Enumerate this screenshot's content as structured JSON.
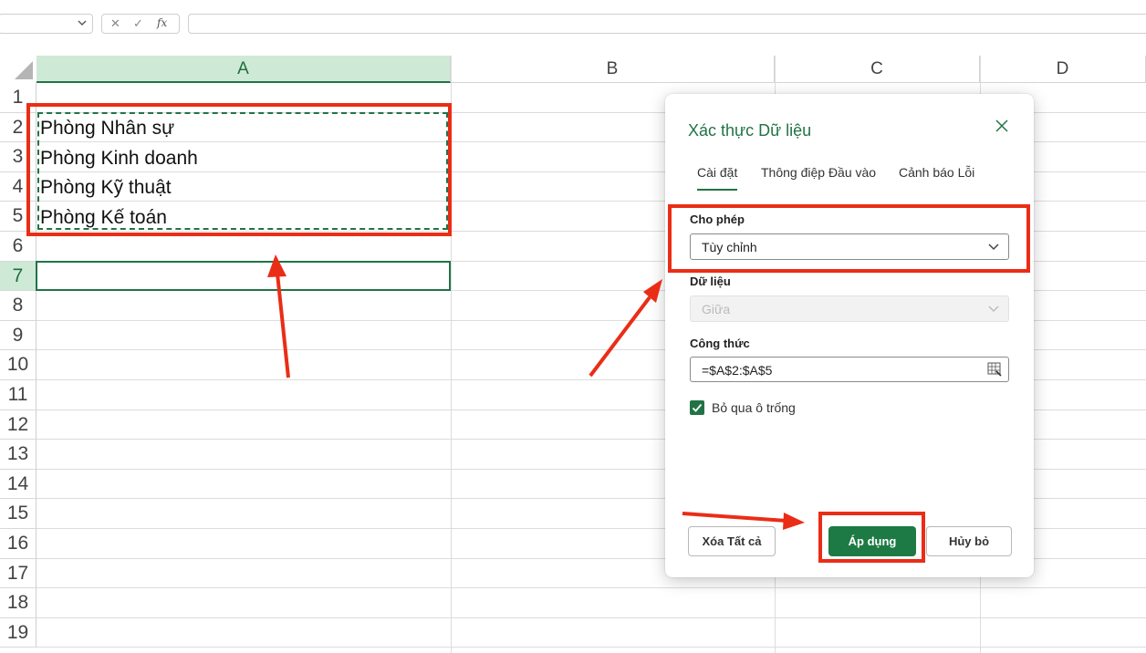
{
  "formula_bar": {
    "cancel_icon": "✕",
    "enter_icon": "✓",
    "fx_label": "fx",
    "formula": ""
  },
  "columns": [
    {
      "label": "A",
      "selected": true
    },
    {
      "label": "B",
      "selected": false
    },
    {
      "label": "C",
      "selected": false
    },
    {
      "label": "D",
      "selected": false
    }
  ],
  "rows": [
    "1",
    "2",
    "3",
    "4",
    "5",
    "6",
    "7",
    "8",
    "9",
    "10",
    "11",
    "12",
    "13",
    "14",
    "15",
    "16",
    "17",
    "18",
    "19"
  ],
  "selected_row": "7",
  "cells": {
    "a2": "Phòng Nhân sự",
    "a3": "Phòng Kinh doanh",
    "a4": "Phòng Kỹ thuật",
    "a5": "Phòng Kế toán"
  },
  "dialog": {
    "title": "Xác thực Dữ liệu",
    "tabs": [
      "Cài đặt",
      "Thông điệp Đầu vào",
      "Cảnh báo Lỗi"
    ],
    "active_tab": "Cài đặt",
    "allow_label": "Cho phép",
    "allow_value": "Tùy chỉnh",
    "data_label": "Dữ liệu",
    "data_value": "Giữa",
    "formula_label": "Công thức",
    "formula_value": "=$A$2:$A$5",
    "ignore_blank_label": "Bỏ qua ô trống",
    "ignore_blank_checked": true,
    "clear_all_label": "Xóa Tất cả",
    "apply_label": "Áp dụng",
    "cancel_label": "Hủy bỏ"
  },
  "colors": {
    "accent": "#217346",
    "annotation": "#ea2d16"
  }
}
